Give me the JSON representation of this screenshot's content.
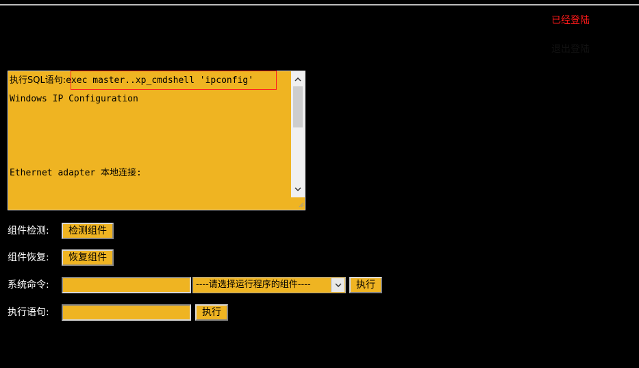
{
  "status": {
    "logged_in": "已经登陆",
    "logout": "退出登陆"
  },
  "output": {
    "prefix": "执行SQL语句:",
    "command": "exec master..xp_cmdshell 'ipconfig'",
    "lines": [
      "",
      "Windows IP Configuration",
      "",
      "",
      "",
      "Ethernet adapter 本地连接:"
    ]
  },
  "rows": {
    "component_check": {
      "label": "组件检测:",
      "button": "检测组件"
    },
    "component_restore": {
      "label": "组件恢复:",
      "button": "恢复组件"
    },
    "system_command": {
      "label": "系统命令:",
      "input_value": "",
      "select_value": "----请选择运行程序的组件----",
      "button": "执行"
    },
    "exec_statement": {
      "label": "执行语句:",
      "input_value": "",
      "button": "执行"
    }
  },
  "colors": {
    "background": "#000000",
    "field": "#efb422",
    "status_red": "#ff1a1a"
  }
}
